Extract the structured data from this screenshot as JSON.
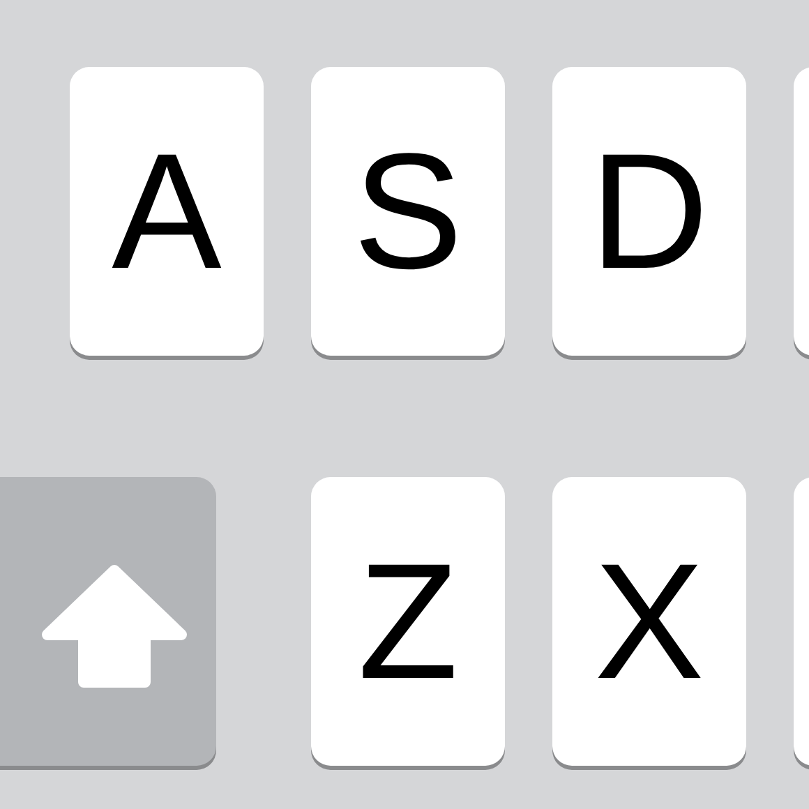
{
  "keyboard": {
    "rows": [
      {
        "keys": [
          {
            "kind": "letter",
            "label": "A"
          },
          {
            "kind": "letter",
            "label": "S"
          },
          {
            "kind": "letter",
            "label": "D"
          },
          {
            "kind": "partial"
          }
        ]
      },
      {
        "keys": [
          {
            "kind": "shift",
            "on": false
          },
          {
            "kind": "letter",
            "label": "Z"
          },
          {
            "kind": "letter",
            "label": "X"
          },
          {
            "kind": "partial"
          }
        ]
      }
    ]
  }
}
